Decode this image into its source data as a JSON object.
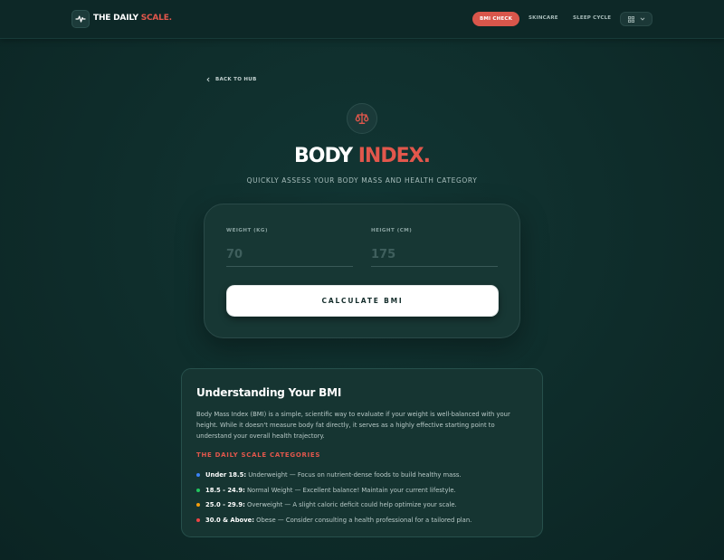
{
  "nav": {
    "brand_main": "THE DAILY ",
    "brand_accent": "SCALE.",
    "active_tab": "BMI CHECK",
    "links": [
      "SKINCARE",
      "SLEEP CYCLE"
    ],
    "logo_icon": "pulse-icon",
    "menu_icon": "grid-icon",
    "menu_chevron": "chevron-down-icon"
  },
  "hero": {
    "back_label": "BACK TO HUB",
    "icon": "scale-icon",
    "title_main": "BODY ",
    "title_accent": "INDEX.",
    "subtitle": "QUICKLY ASSESS YOUR BODY MASS AND HEALTH CATEGORY"
  },
  "form": {
    "weight_label": "WEIGHT (KG)",
    "weight_placeholder": "70",
    "height_label": "HEIGHT (CM)",
    "height_placeholder": "175",
    "submit_label": "CALCULATE BMI"
  },
  "info": {
    "title": "Understanding Your BMI",
    "body": "Body Mass Index (BMI) is a simple, scientific way to evaluate if your weight is well-balanced with your height. While it doesn't measure body fat directly, it serves as a highly effective starting point to understand your overall health trajectory.",
    "categories_heading": "THE DAILY SCALE CATEGORIES",
    "categories": [
      {
        "range": "Under 18.5:",
        "text": " Underweight — Focus on nutrient-dense foods to build healthy mass.",
        "color": "#3b82f6"
      },
      {
        "range": "18.5 - 24.9:",
        "text": " Normal Weight — Excellent balance! Maintain your current lifestyle.",
        "color": "#22c55e"
      },
      {
        "range": "25.0 - 29.9:",
        "text": " Overweight — A slight caloric deficit could help optimize your scale.",
        "color": "#f59e0b"
      },
      {
        "range": "30.0 & Above:",
        "text": " Obese — Consider consulting a health professional for a tailored plan.",
        "color": "#ef4444"
      }
    ]
  },
  "colors": {
    "accent": "#e2574c",
    "background": "#0f2e2c",
    "card": "#173734"
  }
}
